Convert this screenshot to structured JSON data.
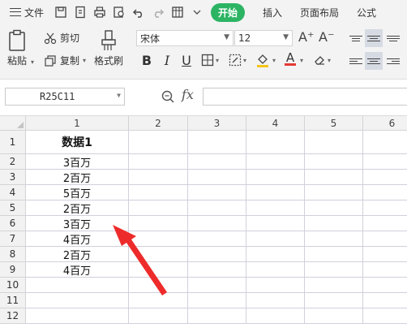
{
  "menubar": {
    "file_label": "文件",
    "tabs": [
      {
        "label": "开始",
        "active": true
      },
      {
        "label": "插入",
        "active": false
      },
      {
        "label": "页面布局",
        "active": false
      },
      {
        "label": "公式",
        "active": false
      }
    ]
  },
  "ribbon": {
    "paste_label": "粘贴",
    "cut_label": "剪切",
    "copy_label": "复制",
    "format_painter_label": "格式刷",
    "font_name": "宋体",
    "font_size": "12",
    "grow_font": "A⁺",
    "shrink_font": "A⁻",
    "bold": "B",
    "italic": "I",
    "underline": "U"
  },
  "formula_bar": {
    "name_box": "R25C11",
    "fx_label": "fx",
    "formula_value": ""
  },
  "sheet": {
    "column_headers": [
      "1",
      "2",
      "3",
      "4",
      "5",
      "6"
    ],
    "row_headers": [
      "1",
      "2",
      "3",
      "4",
      "5",
      "6",
      "7",
      "8",
      "9",
      "10",
      "11",
      "12"
    ],
    "column1_values": [
      "数据1",
      "3百万",
      "2百万",
      "5百万",
      "2百万",
      "3百万",
      "4百万",
      "2百万",
      "4百万",
      "",
      "",
      ""
    ]
  },
  "colors": {
    "accent_green": "#2cb463",
    "annotation_arrow": "#ee2b2b",
    "ribbon_bg": "#f3f3f3",
    "header_bg": "#f2f2f2"
  }
}
